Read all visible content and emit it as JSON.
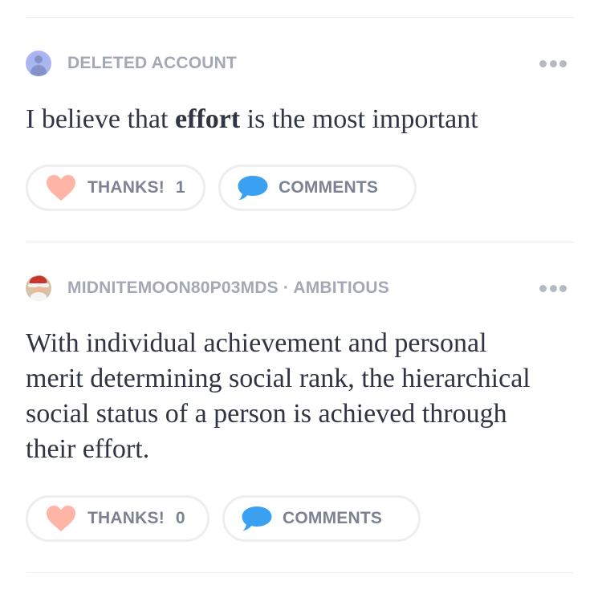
{
  "answers": [
    {
      "author": "DELETED ACCOUNT",
      "content_before": "I believe that ",
      "content_bold": "effort",
      "content_after": " is the most important",
      "thanks_label": "THANKS!",
      "thanks_count": "1",
      "comments_label": "COMMENTS"
    },
    {
      "author": "MIDNITEMOON80P03MDS · AMBITIOUS",
      "content": "With individual achievement and personal merit determining social rank, the hierarchical social status of a person is achieved through their effort.",
      "thanks_label": "THANKS!",
      "thanks_count": "0",
      "comments_label": "COMMENTS"
    }
  ],
  "icons": {
    "thanks": "heart-icon",
    "comments": "speech-bubble-icon",
    "more": "more-options-icon"
  },
  "colors": {
    "heart": "#ffb5a6",
    "bubble": "#3aa0f2",
    "meta_text": "#a3a8b5",
    "button_text": "#7c8292",
    "body_text": "#303443"
  }
}
